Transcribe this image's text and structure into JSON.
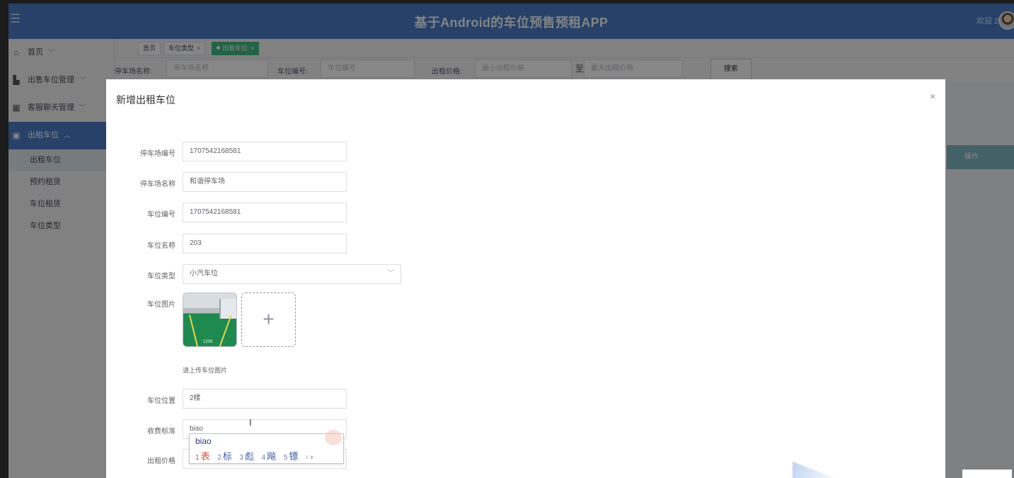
{
  "header": {
    "title": "基于Android的车位预售预租APP",
    "welcome": "欢迎 2",
    "menu_icon": "hamburger-icon"
  },
  "sidebar": {
    "items": [
      {
        "label": "首页",
        "icon": "home-icon"
      },
      {
        "label": "出售车位管理",
        "icon": "chart-icon"
      },
      {
        "label": "客服聊天管理",
        "icon": "grid-icon"
      },
      {
        "label": "出租车位",
        "icon": "panel-icon"
      }
    ],
    "subitems": [
      "出租车位",
      "预约租赁",
      "车位租赁",
      "车位类型"
    ]
  },
  "tabs": [
    {
      "label": "首页"
    },
    {
      "label": "车位类型",
      "close": "×"
    },
    {
      "label": "出租车位",
      "close": "×"
    }
  ],
  "search": {
    "parking_name_label": "停车场名称:",
    "parking_name_placeholder": "停车场名称",
    "space_no_label": "车位编号:",
    "space_no_placeholder": "车位编号",
    "price_label": "出租价格:",
    "min_price_placeholder": "最小出租价格",
    "to_label": "至",
    "max_price_placeholder": "最大出租价格",
    "search_button": "搜索"
  },
  "table": {
    "op_header": "操作"
  },
  "dialog": {
    "title": "新增出租车位",
    "close": "×",
    "fields": {
      "lot_no": {
        "label": "停车场编号",
        "value": "1707542168581"
      },
      "lot_name": {
        "label": "停车场名称",
        "value": "和谐停车场"
      },
      "space_no": {
        "label": "车位编号",
        "value": "1707542168581"
      },
      "space_name": {
        "label": "车位名称",
        "value": "203"
      },
      "space_type": {
        "label": "车位类型",
        "value": "小汽车位"
      },
      "space_image": {
        "label": "车位图片",
        "tip": "请上传车位图片",
        "thumb_caption": "1206"
      },
      "location": {
        "label": "车位位置",
        "value": "2楼"
      },
      "fee_std": {
        "label": "收费标准",
        "value": "biao"
      },
      "rent_price": {
        "label": "出租价格",
        "value": ""
      }
    }
  },
  "ime": {
    "composition": "biao",
    "candidates": [
      {
        "n": "1",
        "c": "表"
      },
      {
        "n": "2",
        "c": "标"
      },
      {
        "n": "3",
        "c": "彪"
      },
      {
        "n": "4",
        "c": "飚"
      },
      {
        "n": "5",
        "c": "镖"
      }
    ],
    "prev": "‹",
    "next": "›"
  }
}
